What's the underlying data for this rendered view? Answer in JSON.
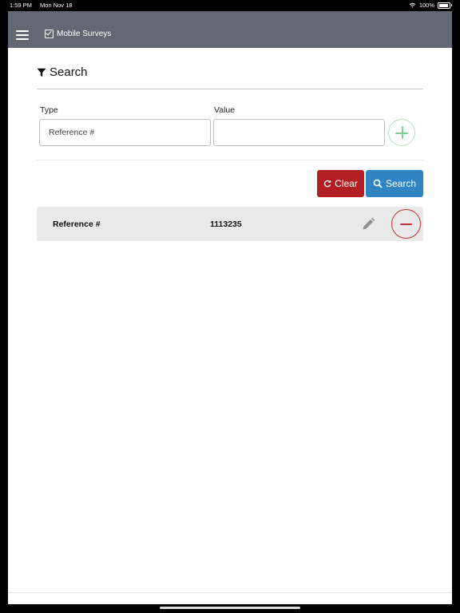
{
  "status": {
    "time": "1:59 PM",
    "date": "Mon Nov 18",
    "battery": "100%"
  },
  "navbar": {
    "title": "Mobile Surveys"
  },
  "search": {
    "heading": "Search",
    "type_label": "Type",
    "value_label": "Value",
    "type_value": "Reference #",
    "value_input": "",
    "clear_label": "Clear",
    "search_label": "Search"
  },
  "results": [
    {
      "type": "Reference #",
      "value": "1113235"
    }
  ],
  "colors": {
    "navbar": "#626773",
    "clear": "#b21f23",
    "search": "#2f84c2",
    "add": "#7ccf8e",
    "remove": "#c0313a"
  },
  "icons": [
    "menu-icon",
    "checkbox-icon",
    "filter-icon",
    "plus-icon",
    "refresh-icon",
    "search-icon",
    "pencil-icon",
    "minus-icon",
    "wifi-icon",
    "battery-icon"
  ]
}
